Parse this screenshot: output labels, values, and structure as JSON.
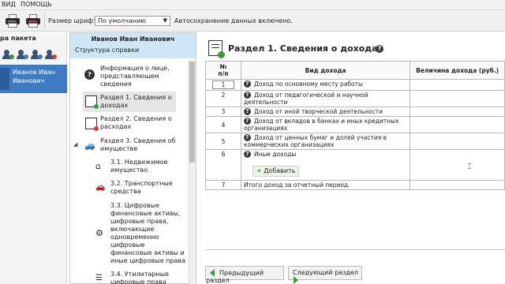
{
  "menu": {
    "items": [
      "ВИД",
      "ПОМОЩЬ"
    ]
  },
  "toolbar": {
    "font_size_label": "Размер шрифта:",
    "font_size_value": "По умолчанию",
    "autosave_text": "Автосохранение данных включено."
  },
  "packet": {
    "title": "ра пакета",
    "person_name": "Иванов Иван Иванович"
  },
  "tree": {
    "header_name": "Иванов Иван Иванович",
    "header_sub": "Структура справки",
    "items": [
      {
        "label": "Информация о лице, представляющем сведения",
        "icon": "info-icon"
      },
      {
        "label": "Раздел 1. Сведения о доходах",
        "icon": "income-doc-icon"
      },
      {
        "label": "Раздел 2. Сведения о расходах",
        "icon": "expense-doc-icon"
      },
      {
        "label": "Раздел 3. Сведения об имуществе",
        "icon": "car-icon"
      },
      {
        "label": "3.1. Недвижимое имущество",
        "icon": "house-icon"
      },
      {
        "label": "3.2. Транспортные средства",
        "icon": "car-icon"
      },
      {
        "label": "3.3. Цифровые финансовые активы, цифровые права, включающие одновременно цифровые финансовые активы и иные цифровые права",
        "icon": "gear-icon"
      },
      {
        "label": "3.4. Утилитарные цифровые права",
        "icon": "stack-icon"
      }
    ]
  },
  "section": {
    "title": "Раздел 1. Сведения о доходах",
    "columns": {
      "num": "№\nп/п",
      "type": "Вид дохода",
      "value": "Величина дохода (руб.)"
    },
    "rows": [
      {
        "n": "1",
        "text": "Доход по основному месту работы"
      },
      {
        "n": "2",
        "text": "Доход от педагогической и научной деятельности"
      },
      {
        "n": "3",
        "text": "Доход от иной творческой деятельности"
      },
      {
        "n": "4",
        "text": "Доход от вкладов в банках и иных кредитных организациях"
      },
      {
        "n": "5",
        "text": "Доход от ценных бумаг и долей участия в коммерческих организациях"
      },
      {
        "n": "6",
        "text": "Иные доходы"
      }
    ],
    "add_button": "Добавить",
    "total": {
      "n": "7",
      "text": "Итого доход за отчетный период"
    }
  },
  "nav": {
    "prev": "Предыдущий раздел",
    "next": "Следующий раздел"
  },
  "colors": {
    "accent_blue": "#3d7bc7",
    "tree_header": "#cfe6f6",
    "green": "#3c9a3c",
    "printer_red": "#d93b3b"
  }
}
